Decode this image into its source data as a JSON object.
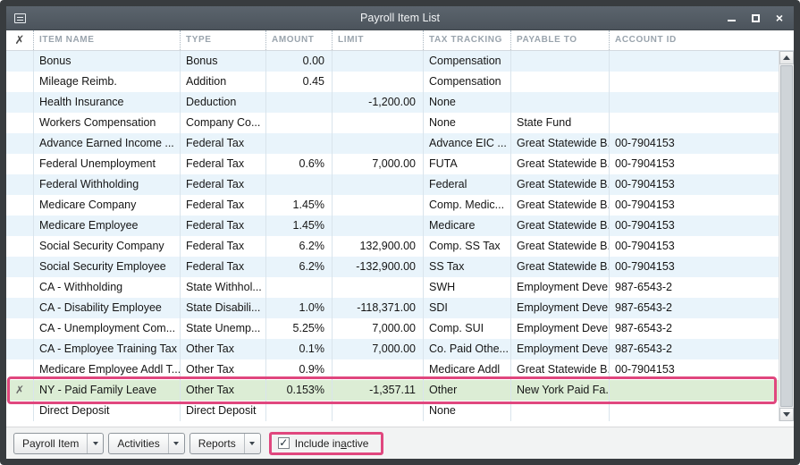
{
  "window": {
    "title": "Payroll Item List"
  },
  "titlebar": {
    "close_glyph": "×"
  },
  "icons": {
    "inactive_glyph": "✗",
    "check_glyph": "✓"
  },
  "table": {
    "columns": [
      "ITEM NAME",
      "TYPE",
      "AMOUNT",
      "LIMIT",
      "TAX TRACKING",
      "PAYABLE TO",
      "ACCOUNT ID"
    ],
    "rows": [
      {
        "cells": [
          "Bonus",
          "Bonus",
          "0.00",
          "",
          "Compensation",
          "",
          ""
        ],
        "inactive": false,
        "highlight": false
      },
      {
        "cells": [
          "Mileage Reimb.",
          "Addition",
          "0.45",
          "",
          "Compensation",
          "",
          ""
        ],
        "inactive": false,
        "highlight": false
      },
      {
        "cells": [
          "Health Insurance",
          "Deduction",
          "",
          "-1,200.00",
          "None",
          "",
          ""
        ],
        "inactive": false,
        "highlight": false
      },
      {
        "cells": [
          "Workers Compensation",
          "Company Co...",
          "",
          "",
          "None",
          "State Fund",
          ""
        ],
        "inactive": false,
        "highlight": false
      },
      {
        "cells": [
          "Advance Earned Income ...",
          "Federal Tax",
          "",
          "",
          "Advance EIC ...",
          "Great Statewide B...",
          "00-7904153"
        ],
        "inactive": false,
        "highlight": false
      },
      {
        "cells": [
          "Federal Unemployment",
          "Federal Tax",
          "0.6%",
          "7,000.00",
          "FUTA",
          "Great Statewide B...",
          "00-7904153"
        ],
        "inactive": false,
        "highlight": false
      },
      {
        "cells": [
          "Federal Withholding",
          "Federal Tax",
          "",
          "",
          "Federal",
          "Great Statewide B...",
          "00-7904153"
        ],
        "inactive": false,
        "highlight": false
      },
      {
        "cells": [
          "Medicare Company",
          "Federal Tax",
          "1.45%",
          "",
          "Comp. Medic...",
          "Great Statewide B...",
          "00-7904153"
        ],
        "inactive": false,
        "highlight": false
      },
      {
        "cells": [
          "Medicare Employee",
          "Federal Tax",
          "1.45%",
          "",
          "Medicare",
          "Great Statewide B...",
          "00-7904153"
        ],
        "inactive": false,
        "highlight": false
      },
      {
        "cells": [
          "Social Security Company",
          "Federal Tax",
          "6.2%",
          "132,900.00",
          "Comp. SS Tax",
          "Great Statewide B...",
          "00-7904153"
        ],
        "inactive": false,
        "highlight": false
      },
      {
        "cells": [
          "Social Security Employee",
          "Federal Tax",
          "6.2%",
          "-132,900.00",
          "SS Tax",
          "Great Statewide B...",
          "00-7904153"
        ],
        "inactive": false,
        "highlight": false
      },
      {
        "cells": [
          "CA - Withholding",
          "State Withhol...",
          "",
          "",
          "SWH",
          "Employment Deve...",
          "987-6543-2"
        ],
        "inactive": false,
        "highlight": false
      },
      {
        "cells": [
          "CA - Disability Employee",
          "State Disabili...",
          "1.0%",
          "-118,371.00",
          "SDI",
          "Employment Deve...",
          "987-6543-2"
        ],
        "inactive": false,
        "highlight": false
      },
      {
        "cells": [
          "CA - Unemployment Com...",
          "State Unemp...",
          "5.25%",
          "7,000.00",
          "Comp. SUI",
          "Employment Deve...",
          "987-6543-2"
        ],
        "inactive": false,
        "highlight": false
      },
      {
        "cells": [
          "CA - Employee Training Tax",
          "Other Tax",
          "0.1%",
          "7,000.00",
          "Co. Paid Othe...",
          "Employment Deve...",
          "987-6543-2"
        ],
        "inactive": false,
        "highlight": false
      },
      {
        "cells": [
          "Medicare Employee Addl T...",
          "Other Tax",
          "0.9%",
          "",
          "Medicare Addl",
          "Great Statewide B...",
          "00-7904153"
        ],
        "inactive": false,
        "highlight": false
      },
      {
        "cells": [
          "NY - Paid Family Leave",
          "Other Tax",
          "0.153%",
          "-1,357.11",
          "Other",
          "New York Paid Fa...",
          ""
        ],
        "inactive": true,
        "highlight": true
      },
      {
        "cells": [
          "Direct Deposit",
          "Direct Deposit",
          "",
          "",
          "None",
          "",
          ""
        ],
        "inactive": false,
        "highlight": false
      }
    ]
  },
  "footer": {
    "buttons": [
      {
        "label": "Payroll Item"
      },
      {
        "label": "Activities"
      },
      {
        "label": "Reports"
      }
    ],
    "checkbox": {
      "pre": "Include in",
      "mnemonic": "a",
      "post": "ctive",
      "checked": true
    }
  },
  "colors": {
    "annotation_pink": "#e0477e",
    "row_alt_blue": "#e9f4fb",
    "highlight_green": "#dcedd5",
    "titlebar_gray": "#545d66"
  }
}
